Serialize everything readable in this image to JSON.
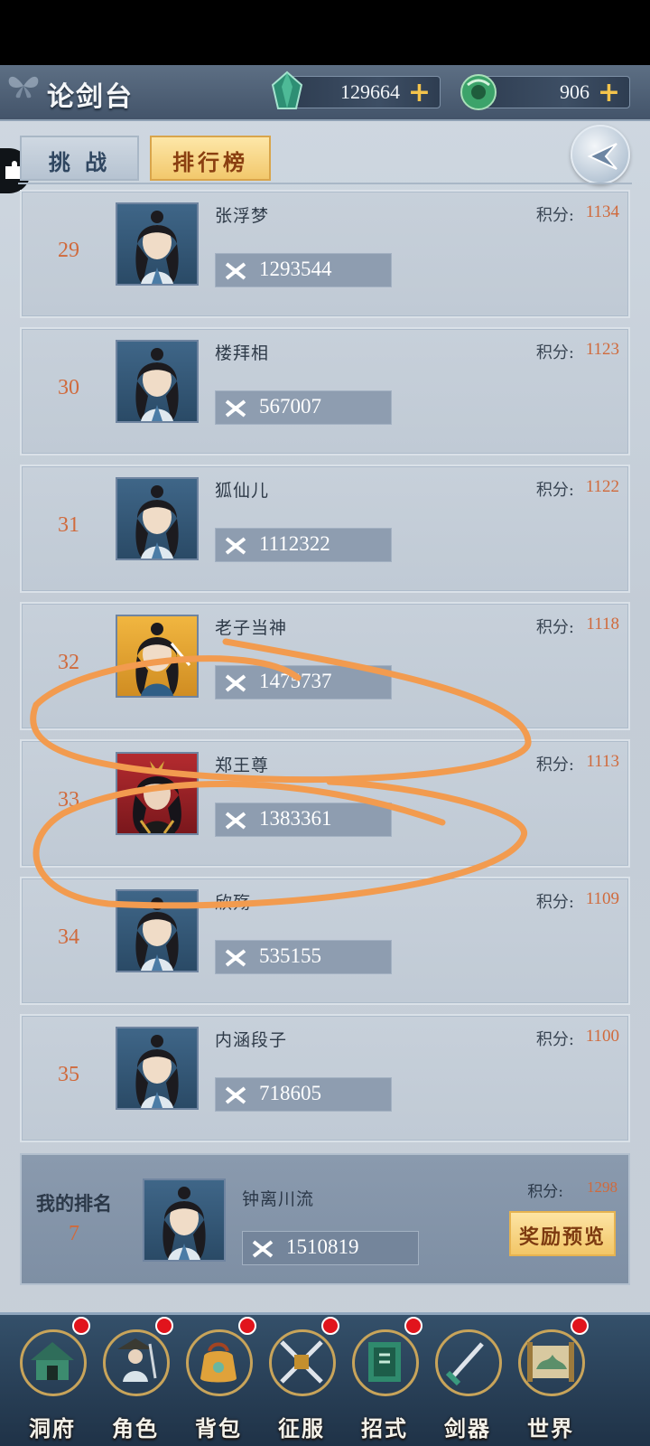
{
  "header": {
    "title": "论剑台",
    "currencies": [
      {
        "name": "gem",
        "icon": "gem-icon",
        "value": "129664",
        "plus": "+"
      },
      {
        "name": "jade",
        "icon": "jade-coin-icon",
        "value": "906",
        "plus": "+"
      }
    ]
  },
  "tabs": [
    {
      "label": "挑 战",
      "active": false
    },
    {
      "label": "排行榜",
      "active": true
    }
  ],
  "score_label": "积分:",
  "rows": [
    {
      "rank": "29",
      "name": "张浮梦",
      "power": "1293544",
      "score": "1134",
      "avatar_frame": "blue"
    },
    {
      "rank": "30",
      "name": "楼拜相",
      "power": "567007",
      "score": "1123",
      "avatar_frame": "blue"
    },
    {
      "rank": "31",
      "name": "狐仙儿",
      "power": "1112322",
      "score": "1122",
      "avatar_frame": "blue"
    },
    {
      "rank": "32",
      "name": "老子当神",
      "power": "1475737",
      "score": "1118",
      "avatar_frame": "gold"
    },
    {
      "rank": "33",
      "name": "郑王尊",
      "power": "1383361",
      "score": "1113",
      "avatar_frame": "red"
    },
    {
      "rank": "34",
      "name": "欣殇",
      "power": "535155",
      "score": "1109",
      "avatar_frame": "blue"
    },
    {
      "rank": "35",
      "name": "内涵段子",
      "power": "718605",
      "score": "1100",
      "avatar_frame": "blue"
    }
  ],
  "my_rank": {
    "label": "我的排名",
    "rank": "7",
    "name": "钟离川流",
    "power": "1510819",
    "score_label": "积分:",
    "score": "1298",
    "reward_button": "奖励预览"
  },
  "nav": [
    {
      "label": "洞府",
      "icon": "cave-dwelling-icon",
      "badge": true
    },
    {
      "label": "角色",
      "icon": "character-icon",
      "badge": true
    },
    {
      "label": "背包",
      "icon": "bag-icon",
      "badge": true
    },
    {
      "label": "征服",
      "icon": "crossed-swords-icon",
      "badge": true
    },
    {
      "label": "招式",
      "icon": "scroll-book-icon",
      "badge": true
    },
    {
      "label": "剑器",
      "icon": "sword-icon",
      "badge": false
    },
    {
      "label": "世界",
      "icon": "world-scroll-icon",
      "badge": true
    }
  ],
  "colors": {
    "accent_orange": "#d06a3c",
    "gold_tab": "#f2c86c",
    "badge_red": "#e1141c",
    "annotation_orange": "#f29b4f"
  }
}
